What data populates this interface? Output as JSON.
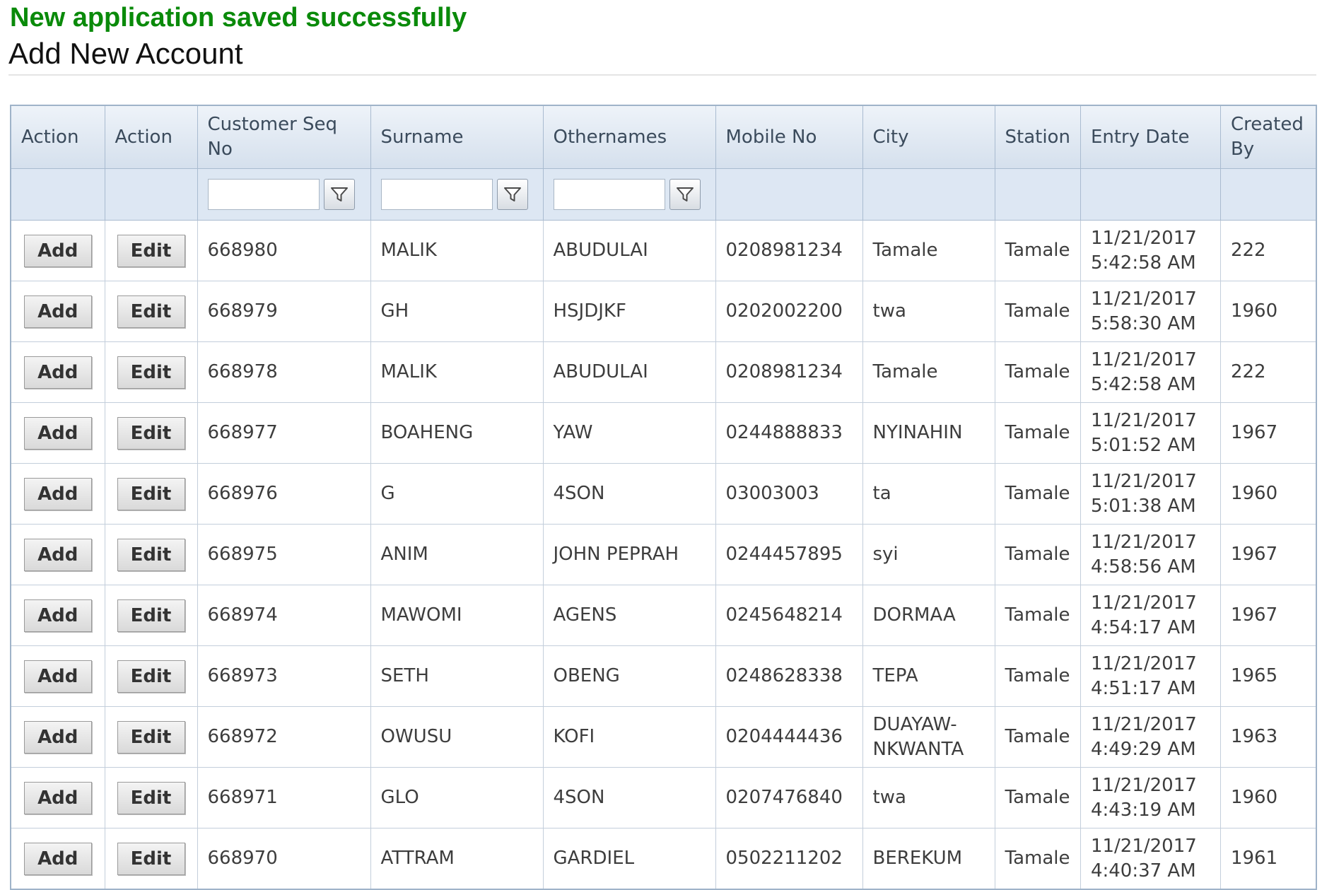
{
  "message": {
    "success": "New application saved successfully"
  },
  "page": {
    "title": "Add New Account"
  },
  "grid": {
    "headers": {
      "action1": "Action",
      "action2": "Action",
      "seq": "Customer Seq No",
      "surname": "Surname",
      "othernames": "Othernames",
      "mobile": "Mobile No",
      "city": "City",
      "station": "Station",
      "entry_date": "Entry Date",
      "created_by": "Created By"
    },
    "add_label": "Add",
    "edit_label": "Edit",
    "filter_icon": "filter-funnel-icon",
    "rows": [
      {
        "seq": "668980",
        "surname": "MALIK",
        "othernames": "ABUDULAI",
        "mobile": "0208981234",
        "city": "Tamale",
        "station": "Tamale",
        "date": "11/21/2017",
        "time": "5:42:58 AM",
        "created_by": "222"
      },
      {
        "seq": "668979",
        "surname": "GH",
        "othernames": "HSJDJKF",
        "mobile": "0202002200",
        "city": "twa",
        "station": "Tamale",
        "date": "11/21/2017",
        "time": "5:58:30 AM",
        "created_by": "1960"
      },
      {
        "seq": "668978",
        "surname": "MALIK",
        "othernames": "ABUDULAI",
        "mobile": "0208981234",
        "city": "Tamale",
        "station": "Tamale",
        "date": "11/21/2017",
        "time": "5:42:58 AM",
        "created_by": "222"
      },
      {
        "seq": "668977",
        "surname": "BOAHENG",
        "othernames": "YAW",
        "mobile": "0244888833",
        "city": "NYINAHIN",
        "station": "Tamale",
        "date": "11/21/2017",
        "time": "5:01:52 AM",
        "created_by": "1967"
      },
      {
        "seq": "668976",
        "surname": "G",
        "othernames": "4SON",
        "mobile": "03003003",
        "city": "ta",
        "station": "Tamale",
        "date": "11/21/2017",
        "time": "5:01:38 AM",
        "created_by": "1960"
      },
      {
        "seq": "668975",
        "surname": "ANIM",
        "othernames": "JOHN PEPRAH",
        "mobile": "0244457895",
        "city": "syi",
        "station": "Tamale",
        "date": "11/21/2017",
        "time": "4:58:56 AM",
        "created_by": "1967"
      },
      {
        "seq": "668974",
        "surname": "MAWOMI",
        "othernames": "AGENS",
        "mobile": "0245648214",
        "city": "DORMAA",
        "station": "Tamale",
        "date": "11/21/2017",
        "time": "4:54:17 AM",
        "created_by": "1967"
      },
      {
        "seq": "668973",
        "surname": "SETH",
        "othernames": "OBENG",
        "mobile": "0248628338",
        "city": "TEPA",
        "station": "Tamale",
        "date": "11/21/2017",
        "time": "4:51:17 AM",
        "created_by": "1965"
      },
      {
        "seq": "668972",
        "surname": "OWUSU",
        "othernames": "KOFI",
        "mobile": "0204444436",
        "city": "DUAYAW-NKWANTA",
        "station": "Tamale",
        "date": "11/21/2017",
        "time": "4:49:29 AM",
        "created_by": "1963"
      },
      {
        "seq": "668971",
        "surname": "GLO",
        "othernames": "4SON",
        "mobile": "0207476840",
        "city": "twa",
        "station": "Tamale",
        "date": "11/21/2017",
        "time": "4:43:19 AM",
        "created_by": "1960"
      },
      {
        "seq": "668970",
        "surname": "ATTRAM",
        "othernames": "GARDIEL",
        "mobile": "0502211202",
        "city": "BEREKUM",
        "station": "Tamale",
        "date": "11/21/2017",
        "time": "4:40:37 AM",
        "created_by": "1961"
      }
    ]
  }
}
